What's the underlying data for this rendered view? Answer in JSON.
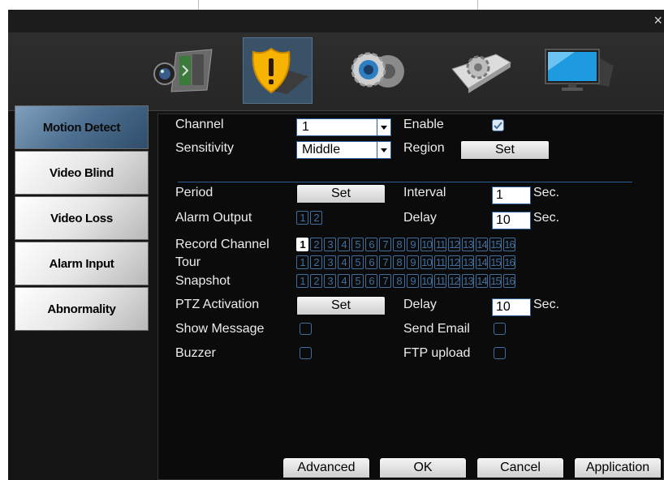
{
  "window": {
    "close_symbol": "×"
  },
  "toolbar_icons": [
    {
      "name": "record-camera-icon"
    },
    {
      "name": "alarm-shield-icon",
      "selected": true
    },
    {
      "name": "system-gear-icon"
    },
    {
      "name": "advanced-settings-icon"
    },
    {
      "name": "monitor-info-icon"
    }
  ],
  "sidebar": {
    "items": [
      {
        "label": "Motion Detect",
        "active": true
      },
      {
        "label": "Video Blind"
      },
      {
        "label": "Video Loss"
      },
      {
        "label": "Alarm Input"
      },
      {
        "label": "Abnormality"
      }
    ]
  },
  "form": {
    "channel_label": "Channel",
    "channel_value": "1",
    "enable_label": "Enable",
    "enable_checked": true,
    "sensitivity_label": "Sensitivity",
    "sensitivity_value": "Middle",
    "region_label": "Region",
    "region_button": "Set",
    "period_label": "Period",
    "period_button": "Set",
    "interval_label": "Interval",
    "interval_value": "1",
    "interval_unit": "Sec.",
    "alarm_output_label": "Alarm Output",
    "alarm_outputs": [
      "1",
      "2"
    ],
    "delay_label": "Delay",
    "delay_value": "10",
    "delay_unit": "Sec.",
    "record_channel_label": "Record Channel",
    "tour_label": "Tour",
    "snapshot_label": "Snapshot",
    "channels": [
      "1",
      "2",
      "3",
      "4",
      "5",
      "6",
      "7",
      "8",
      "9",
      "10",
      "11",
      "12",
      "13",
      "14",
      "15",
      "16"
    ],
    "record_selected": [
      "1"
    ],
    "ptz_label": "PTZ Activation",
    "ptz_button": "Set",
    "ptz_delay_label": "Delay",
    "ptz_delay_value": "10",
    "ptz_delay_unit": "Sec.",
    "show_message_label": "Show Message",
    "send_email_label": "Send Email",
    "buzzer_label": "Buzzer",
    "ftp_label": "FTP upload"
  },
  "buttons": {
    "advanced": "Advanced",
    "ok": "OK",
    "cancel": "Cancel",
    "application": "Application"
  },
  "colors": {
    "accent": "#2a5d94",
    "active_tab": "#4d6f8f",
    "background": "#0b0b0b"
  }
}
